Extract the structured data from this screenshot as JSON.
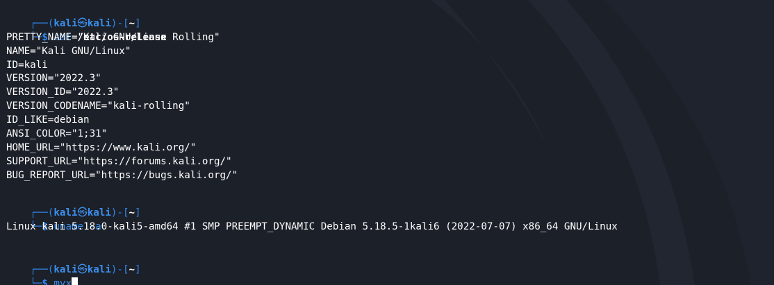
{
  "prompt": {
    "user": "kali",
    "separator": "㉿",
    "host": "kali",
    "path": "~",
    "symbol": "$",
    "frame_top": "┌──(",
    "frame_mid": ")-[",
    "frame_end": "]",
    "frame_bottom": "└─"
  },
  "commands": [
    {
      "command": "cat",
      "argument": "/etc/os-release",
      "output": [
        "PRETTY_NAME=\"Kali GNU/Linux Rolling\"",
        "NAME=\"Kali GNU/Linux\"",
        "ID=kali",
        "VERSION=\"2022.3\"",
        "VERSION_ID=\"2022.3\"",
        "VERSION_CODENAME=\"kali-rolling\"",
        "ID_LIKE=debian",
        "ANSI_COLOR=\"1;31\"",
        "HOME_URL=\"https://www.kali.org/\"",
        "SUPPORT_URL=\"https://forums.kali.org/\"",
        "BUG_REPORT_URL=\"https://bugs.kali.org/\""
      ]
    },
    {
      "command": "uname -a",
      "output": [
        "Linux kali 5.18.0-kali5-amd64 #1 SMP PREEMPT_DYNAMIC Debian 5.18.5-1kali6 (2022-07-07) x86_64 GNU/Linux"
      ]
    }
  ],
  "current_input": "myx",
  "colors": {
    "background": "#1c2029",
    "prompt": "#2f87ee",
    "text": "#ffffff"
  }
}
